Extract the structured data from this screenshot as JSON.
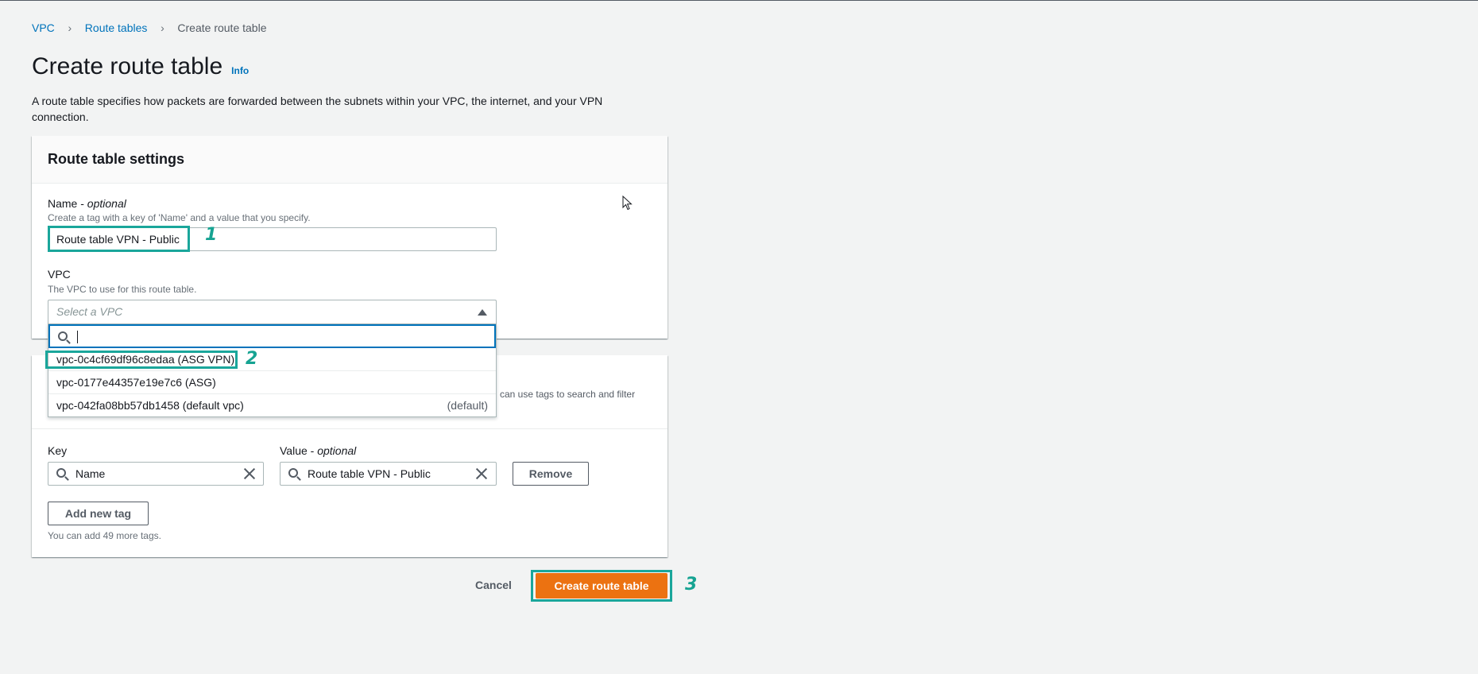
{
  "breadcrumb": {
    "item1": "VPC",
    "item2": "Route tables",
    "current": "Create route table"
  },
  "page": {
    "title": "Create route table",
    "info": "Info",
    "description": "A route table specifies how packets are forwarded between the subnets within your VPC, the internet, and your VPN connection."
  },
  "settings": {
    "header": "Route table settings",
    "name_label": "Name - ",
    "name_optional": "optional",
    "name_hint": "Create a tag with a key of 'Name' and a value that you specify.",
    "name_value": "Route table VPN - Public",
    "vpc_label": "VPC",
    "vpc_hint": "The VPC to use for this route table.",
    "vpc_placeholder": "Select a VPC"
  },
  "dropdown": {
    "options": [
      {
        "label": "vpc-0c4cf69df96c8edaa (ASG VPN)",
        "tag": ""
      },
      {
        "label": "vpc-0177e44357e19e7c6 (ASG)",
        "tag": ""
      },
      {
        "label": "vpc-042fa08bb57db1458 (default vpc)",
        "tag": "(default)"
      }
    ]
  },
  "tags": {
    "hint_fragment": "can use tags to search and filter",
    "key_label": "Key",
    "value_label": "Value - ",
    "value_optional": "optional",
    "key_value": "Name",
    "value_value": "Route table VPN - Public",
    "remove_label": "Remove",
    "add_label": "Add new tag",
    "limit_text": "You can add 49 more tags."
  },
  "actions": {
    "cancel": "Cancel",
    "create": "Create route table"
  },
  "markers": {
    "m1": "1",
    "m2": "2",
    "m3": "3"
  },
  "colors": {
    "accent": "#ec7211",
    "link": "#0073bb",
    "annotation": "#1aa69b"
  }
}
